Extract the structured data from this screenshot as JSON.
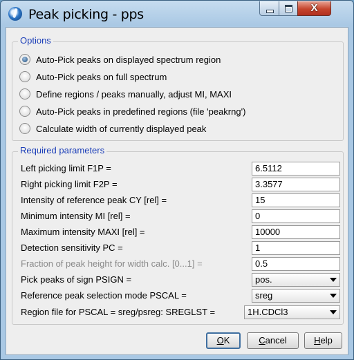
{
  "window": {
    "title": "Peak picking - pps",
    "close_glyph": "X"
  },
  "options": {
    "legend": "Options",
    "items": [
      {
        "label": "Auto-Pick peaks on displayed spectrum region",
        "selected": true
      },
      {
        "label": "Auto-Pick peaks on full spectrum",
        "selected": false
      },
      {
        "label": "Define regions / peaks manually, adjust MI, MAXI",
        "selected": false
      },
      {
        "label": "Auto-Pick peaks in predefined regions (file 'peakrng')",
        "selected": false
      },
      {
        "label": "Calculate width of currently displayed peak",
        "selected": false
      }
    ]
  },
  "params": {
    "legend": "Required parameters",
    "rows": [
      {
        "label": "Left picking limit F1P =",
        "value": "6.5112"
      },
      {
        "label": "Right picking limit F2P =",
        "value": "3.3577"
      },
      {
        "label": "Intensity of reference peak CY [rel] =",
        "value": "15"
      },
      {
        "label": "Minimum intensity MI [rel] =",
        "value": "0"
      },
      {
        "label": "Maximum intensity MAXI [rel] =",
        "value": "10000"
      },
      {
        "label": "Detection sensitivity PC =",
        "value": "1"
      },
      {
        "label": "Fraction of peak height for width calc. [0...1] =",
        "value": "0.5"
      },
      {
        "label": "Pick peaks of sign PSIGN =",
        "value": "pos."
      },
      {
        "label": "Reference peak selection mode PSCAL =",
        "value": "sreg"
      },
      {
        "label": "Region file for PSCAL = sreg/psreg: SREGLST =",
        "value": "1H.CDCl3"
      }
    ]
  },
  "buttons": {
    "ok": {
      "prefix": "",
      "mnemonic": "O",
      "rest": "K"
    },
    "cancel": {
      "prefix": "",
      "mnemonic": "C",
      "rest": "ancel"
    },
    "help": {
      "prefix": "",
      "mnemonic": "H",
      "rest": "elp"
    }
  },
  "icons": {
    "app": "topspin-app-icon",
    "minimize": "minimize-icon",
    "maximize": "maximize-icon",
    "close": "close-icon",
    "dropdown": "chevron-down-icon"
  }
}
